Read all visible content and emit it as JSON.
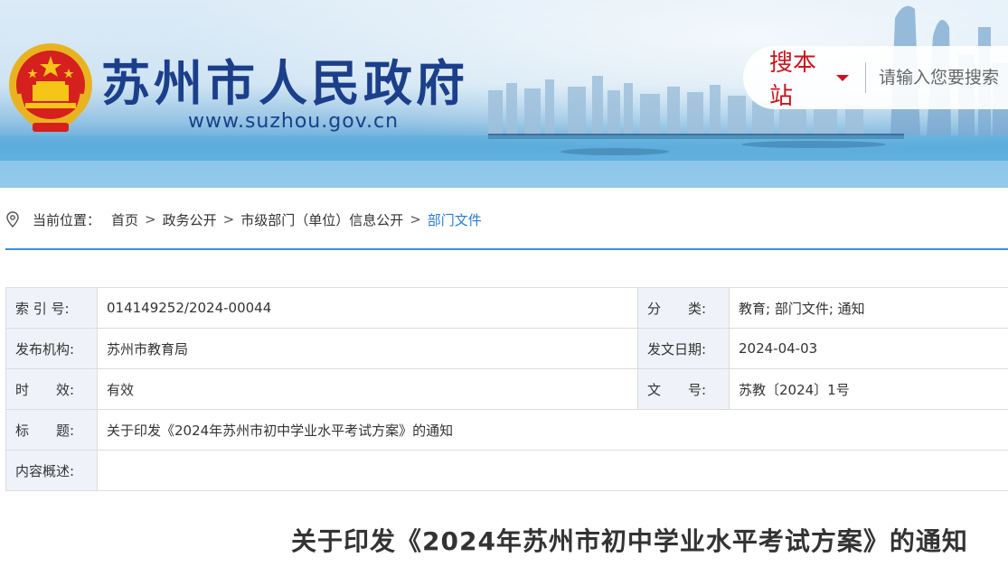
{
  "header": {
    "site_title": "苏州市人民政府",
    "site_url": "www.suzhou.gov.cn",
    "emblem_icon": "national-emblem-icon",
    "search": {
      "scope_label": "搜本站",
      "placeholder": "请输入您要搜索",
      "accent_color": "#c8161e"
    }
  },
  "breadcrumb": {
    "prefix": "当前位置：",
    "items": [
      "首页",
      "政务公开",
      "市级部门（单位）信息公开",
      "部门文件"
    ],
    "separator": ">",
    "current_color": "#2a7bd3"
  },
  "info": {
    "index_label": "索 引 号:",
    "index_value": "014149252/2024-00044",
    "category_label": "分　　类:",
    "category_value": "教育;  部门文件;  通知",
    "publisher_label": "发布机构:",
    "publisher_value": "苏州市教育局",
    "date_label": "发文日期:",
    "date_value": "2024-04-03",
    "validity_label": "时　　效:",
    "validity_value": "有效",
    "docno_label": "文　　号:",
    "docno_value": "苏教〔2024〕1号",
    "title_label": "标　　题:",
    "title_value": "关于印发《2024年苏州市初中学业水平考试方案》的通知",
    "summary_label": "内容概述:",
    "summary_value": ""
  },
  "document": {
    "heading": "关于印发《2024年苏州市初中学业水平考试方案》的通知"
  }
}
